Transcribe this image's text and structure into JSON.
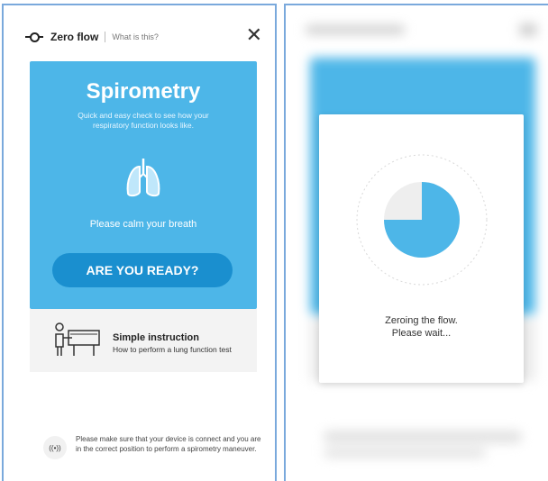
{
  "header": {
    "title": "Zero flow",
    "what_is_this": "What is this?",
    "close_glyph": "✕"
  },
  "card": {
    "title": "Spirometry",
    "subtitle": "Quick and easy check to see how your respiratory function looks like.",
    "calm_message": "Please calm your breath",
    "ready_button": "ARE YOU READY?"
  },
  "instruction": {
    "title": "Simple instruction",
    "description": "How to perform a lung function test"
  },
  "notice": {
    "icon_glyph": "((•))",
    "text": "Please make sure that your device is connect and you are in the correct position to perform a spirometry maneuver."
  },
  "modal": {
    "progress_fraction": 0.75,
    "message_line1": "Zeroing the flow.",
    "message_line2": "Please wait..."
  },
  "colors": {
    "accent_blue": "#4db6e8",
    "button_blue": "#1a8fcf",
    "light_gray": "#f3f3f3"
  }
}
